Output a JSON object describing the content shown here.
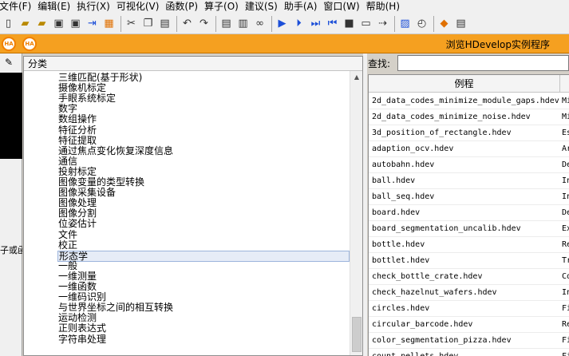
{
  "menu": [
    "文件(F)",
    "编辑(E)",
    "执行(X)",
    "可视化(V)",
    "函数(P)",
    "算子(O)",
    "建议(S)",
    "助手(A)",
    "窗口(W)",
    "帮助(H)"
  ],
  "toolbar": {
    "icons": [
      "new-icon",
      "open-icon",
      "open-folder-icon",
      "save-icon",
      "save-all-icon",
      "export-icon",
      "image-icon",
      "cut-icon",
      "copy-icon",
      "paste-icon",
      "undo-icon",
      "redo-icon",
      "edit-procedure-icon",
      "edit-icon",
      "binoculars-icon",
      "run-icon",
      "step-icon",
      "step-over-icon",
      "step-back-icon",
      "stop-icon",
      "reset-icon",
      "program-counter-icon",
      "breakpoint-icon",
      "timer-icon",
      "help-icon",
      "hdevelop-help-icon"
    ]
  },
  "header_bar": {
    "logo": "HA",
    "title": "浏览HDevelop实例程序"
  },
  "left_strip": {
    "text": "子或函"
  },
  "categories": {
    "header": "分类",
    "items": [
      "三维匹配(基于形状)",
      "摄像机标定",
      "手眼系统标定",
      "数字",
      "数组操作",
      "特征分析",
      "特征提取",
      "通过焦点变化恢复深度信息",
      "通信",
      "投射标定",
      "图像变量的类型转换",
      "图像采集设备",
      "图像处理",
      "图像分割",
      "位姿估计",
      "文件",
      "校正",
      "形态学",
      "一般",
      "一维测量",
      "一维函数",
      "一维码识别",
      "与世界坐标之间的相互转换",
      "运动检测",
      "正则表达式",
      "字符串处理"
    ],
    "selected": "形态学"
  },
  "search": {
    "label": "查找:",
    "value": ""
  },
  "examples": {
    "header": "例程",
    "rows": [
      {
        "name": "2d_data_codes_minimize_module_gaps.hdev",
        "desc": "Mi"
      },
      {
        "name": "2d_data_codes_minimize_noise.hdev",
        "desc": "Mi"
      },
      {
        "name": "3d_position_of_rectangle.hdev",
        "desc": "Es"
      },
      {
        "name": "adaption_ocv.hdev",
        "desc": "Ar"
      },
      {
        "name": "autobahn.hdev",
        "desc": "De"
      },
      {
        "name": "ball.hdev",
        "desc": "In"
      },
      {
        "name": "ball_seq.hdev",
        "desc": "In"
      },
      {
        "name": "board.hdev",
        "desc": "De"
      },
      {
        "name": "board_segmentation_uncalib.hdev",
        "desc": "Ex"
      },
      {
        "name": "bottle.hdev",
        "desc": "Re"
      },
      {
        "name": "bottlet.hdev",
        "desc": "Tr"
      },
      {
        "name": "check_bottle_crate.hdev",
        "desc": "Co"
      },
      {
        "name": "check_hazelnut_wafers.hdev",
        "desc": "In"
      },
      {
        "name": "circles.hdev",
        "desc": "Fi"
      },
      {
        "name": "circular_barcode.hdev",
        "desc": "Re"
      },
      {
        "name": "color_segmentation_pizza.hdev",
        "desc": "Fi"
      },
      {
        "name": "count_pellets.hdev",
        "desc": "Fi"
      }
    ]
  }
}
